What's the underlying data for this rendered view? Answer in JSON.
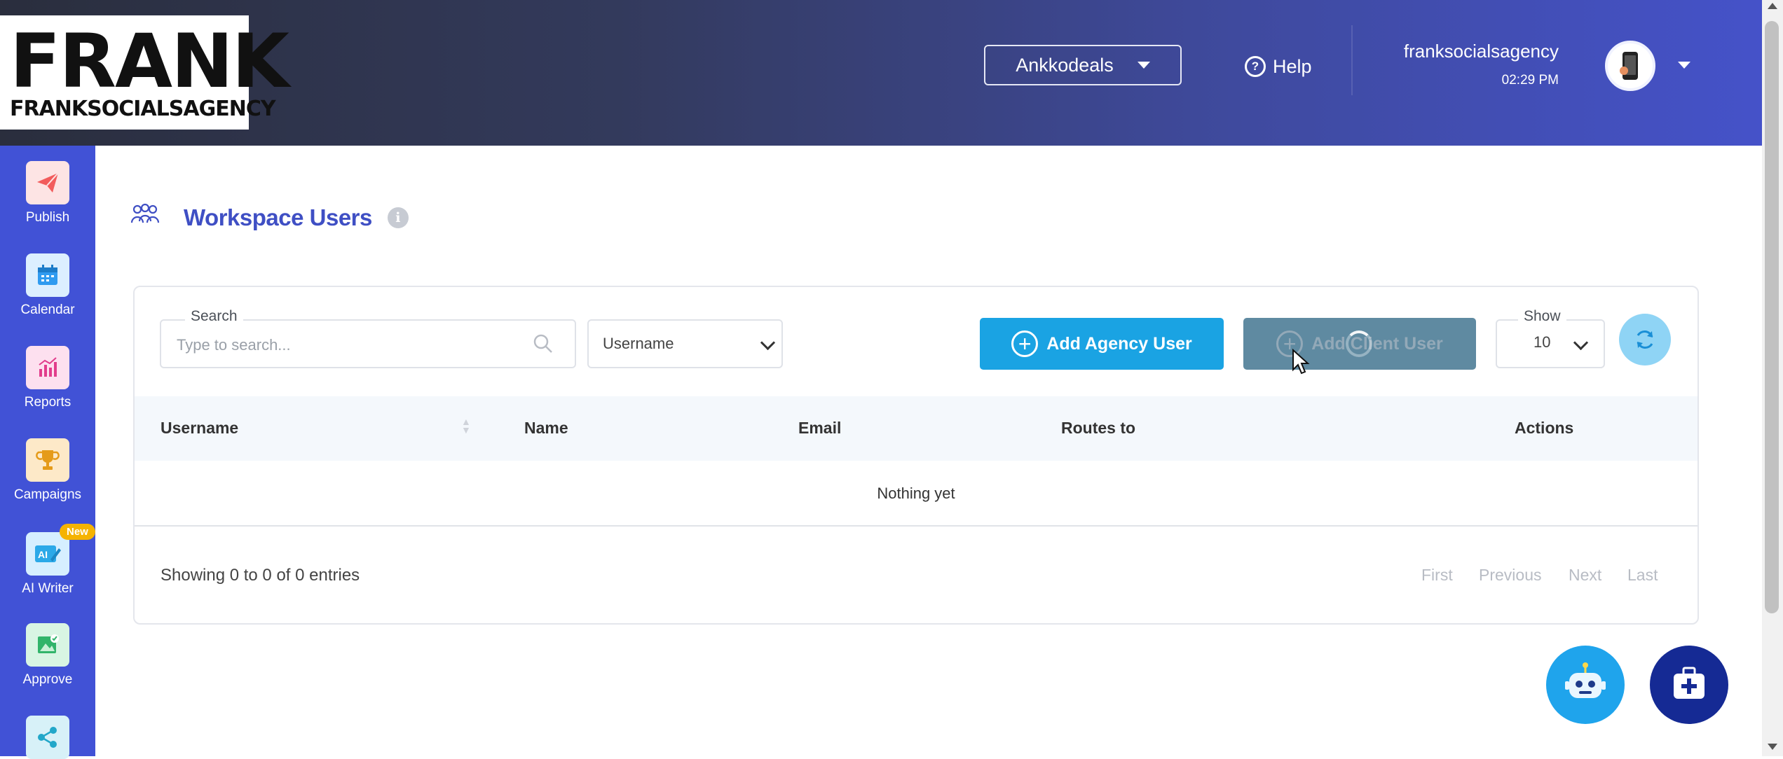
{
  "brand": {
    "logo_big": "FRANK",
    "logo_small": "FRANKSOCIALSAGENCY"
  },
  "header": {
    "workspace": "Ankkodeals",
    "help_label": "Help",
    "username": "franksocialsagency",
    "time": "02:29 PM"
  },
  "sidebar": {
    "items": [
      {
        "label": "Publish",
        "icon": "paper-plane-icon",
        "color": "#f25c5c"
      },
      {
        "label": "Calendar",
        "icon": "calendar-icon",
        "color": "#2f9bf0"
      },
      {
        "label": "Reports",
        "icon": "bar-chart-icon",
        "color": "#e23d8c"
      },
      {
        "label": "Campaigns",
        "icon": "trophy-icon",
        "color": "#e59b1a"
      },
      {
        "label": "AI Writer",
        "icon": "ai-pen-icon",
        "color": "#2ba9e8",
        "badge": "New"
      },
      {
        "label": "Approve",
        "icon": "image-check-icon",
        "color": "#31b46a"
      },
      {
        "label": "",
        "icon": "share-icon",
        "color": "#22a7c9"
      }
    ]
  },
  "page": {
    "title": "Workspace Users"
  },
  "toolbar": {
    "search_label": "Search",
    "search_placeholder": "Type to search...",
    "search_value": "",
    "filter_field": "Username",
    "add_agency_label": "Add Agency User",
    "add_client_label": "Add Client User",
    "show_label": "Show",
    "show_value": "10"
  },
  "table": {
    "columns": [
      "Username",
      "Name",
      "Email",
      "Routes to",
      "Actions"
    ],
    "empty_text": "Nothing yet",
    "entries_text": "Showing 0 to 0 of 0 entries",
    "pagination": [
      "First",
      "Previous",
      "Next",
      "Last"
    ]
  },
  "colors": {
    "accent": "#3f4fc4",
    "primary_button": "#1aa3e3",
    "disabled_button": "#5f8aa1",
    "sidebar_bg": "#4152d6"
  }
}
